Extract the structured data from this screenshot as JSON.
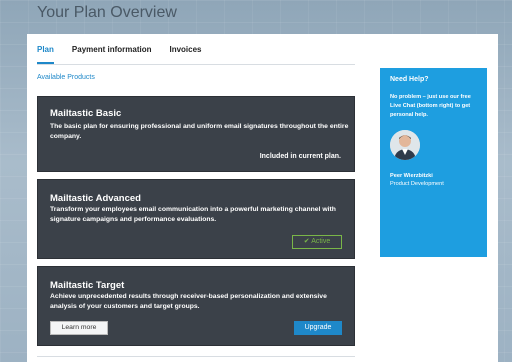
{
  "page": {
    "title": "Your Plan Overview"
  },
  "tabs": [
    {
      "label": "Plan",
      "active": true
    },
    {
      "label": "Payment information",
      "active": false
    },
    {
      "label": "Invoices",
      "active": false
    }
  ],
  "section": {
    "label": "Available Products"
  },
  "products": [
    {
      "name": "Mailtastic Basic",
      "description": "The basic plan for ensuring professional and uniform email signatures throughout the entire company.",
      "status": "Included in current plan."
    },
    {
      "name": "Mailtastic Advanced",
      "description": "Transform your employees email communication into a powerful marketing channel with signature campaigns and performance evaluations.",
      "active_label": "Active"
    },
    {
      "name": "Mailtastic Target",
      "description": "Achieve unprecedented results through receiver-based personalization and extensive analysis of your customers and target groups.",
      "learn_more_label": "Learn more",
      "upgrade_label": "Upgrade"
    }
  ],
  "help": {
    "title": "Need Help?",
    "text": "No problem – just use our free Live Chat (bottom right) to get personal help.",
    "name": "Peer Wierzbitzki",
    "role": "Product Development"
  },
  "colors": {
    "accent": "#1e88c9",
    "help_bg": "#1e9ee0",
    "card_dark": "#3b4149",
    "active_green": "#7ab648"
  }
}
